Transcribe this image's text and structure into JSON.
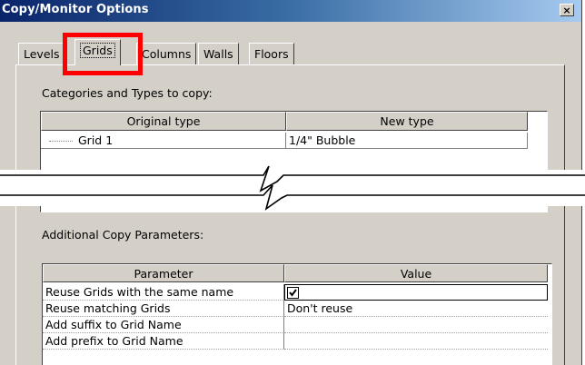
{
  "dialog": {
    "title": "Copy/Monitor Options",
    "close_glyph": "×"
  },
  "tabs": [
    {
      "label": "Levels",
      "active": false
    },
    {
      "label": "Grids",
      "active": true
    },
    {
      "label": "Columns",
      "active": false
    },
    {
      "label": "Walls",
      "active": false
    },
    {
      "label": "Floors",
      "active": false
    }
  ],
  "categories": {
    "label": "Categories and Types to copy:",
    "columns": [
      "Original type",
      "New type"
    ],
    "rows": [
      {
        "original": "Grid 1",
        "new": "1/4\" Bubble"
      }
    ]
  },
  "additional": {
    "label": "Additional Copy Parameters:",
    "columns": [
      "Parameter",
      "Value"
    ],
    "rows": [
      {
        "parameter": "Reuse Grids with the same name",
        "value": "",
        "checkbox_checked": true
      },
      {
        "parameter": "Reuse matching Grids",
        "value": "Don't reuse"
      },
      {
        "parameter": "Add suffix to Grid Name",
        "value": ""
      },
      {
        "parameter": "Add prefix to Grid Name",
        "value": ""
      }
    ]
  },
  "icons": {
    "close": "close-icon",
    "checkbox": "check-icon",
    "break": "break-line-icon"
  },
  "colors": {
    "highlight": "#ff0000",
    "titlebar": "#0a246a",
    "dialog_bg": "#d4d0c8"
  }
}
